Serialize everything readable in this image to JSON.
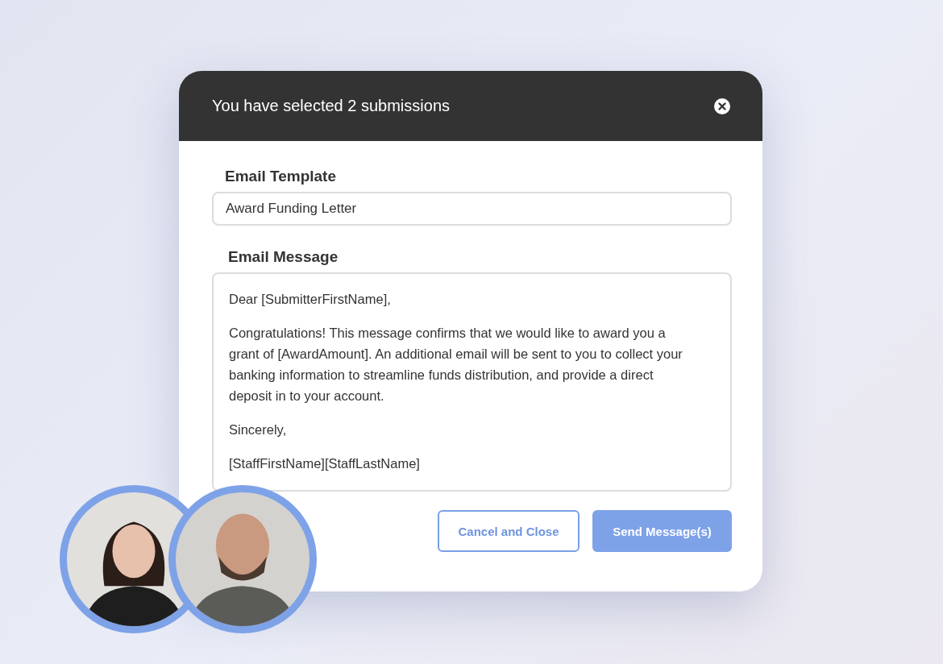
{
  "dialog": {
    "title": "You have selected 2 submissions",
    "template": {
      "label": "Email Template",
      "value": "Award Funding Letter"
    },
    "message": {
      "label": "Email Message",
      "paragraphs": [
        "Dear [SubmitterFirstName],",
        "Congratulations! This message confirms that we would like to award you a grant of [AwardAmount]. An additional email will be sent to you to collect your banking information to streamline funds distribution, and provide a direct deposit in to your account.",
        "Sincerely,",
        "[StaffFirstName][StaffLastName]"
      ]
    },
    "buttons": [
      {
        "kind": "secondary",
        "label": "Cancel and Close"
      },
      {
        "kind": "primary",
        "label": "Send Message(s)"
      }
    ]
  }
}
